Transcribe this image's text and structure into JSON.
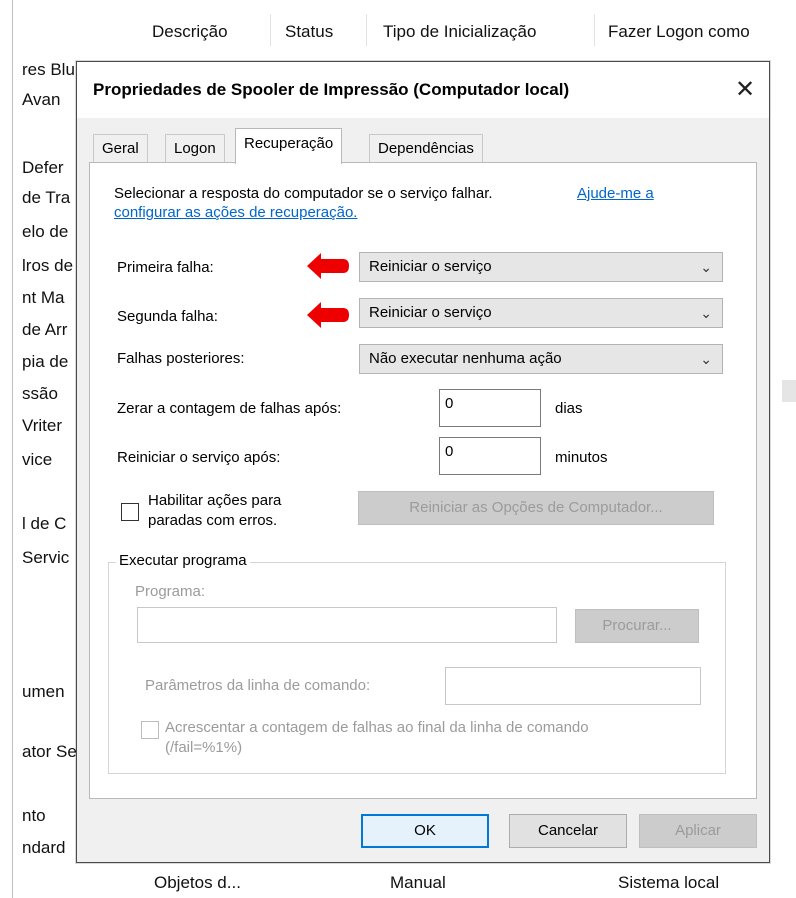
{
  "background": {
    "columns": [
      "Descrição",
      "Status",
      "Tipo de Inicialização",
      "Fazer Logon como"
    ],
    "rows": [
      "res Blu",
      "Avan",
      "Defer",
      "de Tra",
      "elo de",
      "lros de",
      "nt Ma",
      "de Arr",
      "pia de",
      "ssão",
      "Vriter",
      "vice",
      "l de C",
      "Servic",
      "umen",
      "ator Se",
      "nto",
      "ndard"
    ],
    "bottom_row": [
      "Objetos d...",
      "Manual",
      "Sistema local"
    ]
  },
  "dialog": {
    "title": "Propriedades de Spooler de Impressão (Computador local)",
    "close_glyph": "✕",
    "tabs": [
      {
        "label": "Geral"
      },
      {
        "label": "Logon"
      },
      {
        "label": "Recuperação"
      },
      {
        "label": "Dependências"
      }
    ],
    "intro_text_1": "Selecionar a resposta do computador se o serviço falhar.",
    "intro_link_1": "Ajude-me a",
    "intro_link_2": "configurar as ações de recuperação.",
    "first_failure_label": "Primeira falha:",
    "first_failure_value": "Reiniciar o serviço",
    "second_failure_label": "Segunda falha:",
    "second_failure_value": "Reiniciar o serviço",
    "subsequent_failures_label": "Falhas posteriores:",
    "subsequent_failures_value": "Não executar nenhuma ação",
    "reset_count_label": "Zerar a contagem de falhas após:",
    "reset_count_value": "0",
    "reset_count_unit": "dias",
    "restart_after_label": "Reiniciar o serviço após:",
    "restart_after_value": "0",
    "restart_after_unit": "minutos",
    "enable_actions_label_1": "Habilitar ações para",
    "enable_actions_label_2": "paradas com erros.",
    "restart_computer_options_button": "Reiniciar as Opções de Computador...",
    "run_program": {
      "group_label": "Executar programa",
      "program_label": "Programa:",
      "browse_button": "Procurar...",
      "params_label": "Parâmetros da linha de comando:",
      "append_label_1": "Acrescentar a contagem de falhas ao final da linha de comando",
      "append_label_2": "(/fail=%1%)"
    },
    "buttons": {
      "ok": "OK",
      "cancel": "Cancelar",
      "apply": "Aplicar"
    }
  },
  "colors": {
    "link": "#0066cc",
    "annotation_arrow": "#ee0000",
    "focus_border": "#0078d7"
  }
}
